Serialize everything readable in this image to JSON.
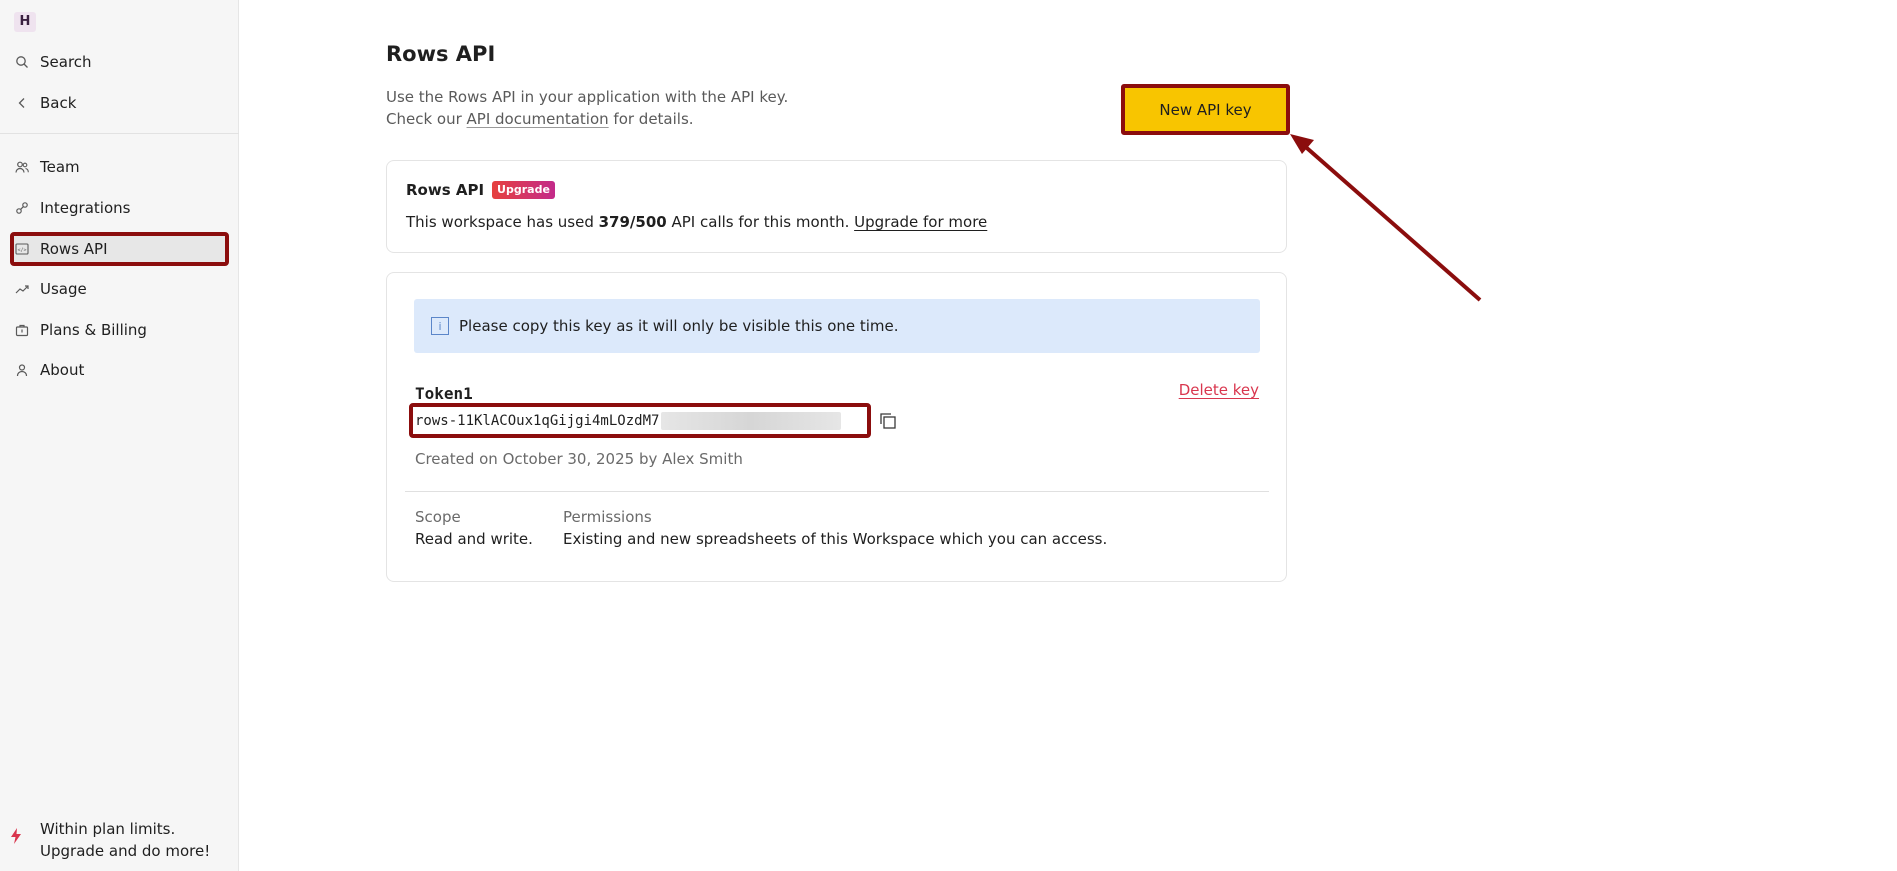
{
  "sidebar": {
    "workspace_initial": "H",
    "top_items": [
      {
        "label": "Search",
        "icon": "search-icon"
      },
      {
        "label": "Back",
        "icon": "chevron-left-icon"
      }
    ],
    "items": [
      {
        "label": "Team",
        "icon": "team-icon"
      },
      {
        "label": "Integrations",
        "icon": "integrations-icon"
      },
      {
        "label": "Rows API",
        "icon": "code-icon",
        "active": true
      },
      {
        "label": "Usage",
        "icon": "trend-icon"
      },
      {
        "label": "Plans & Billing",
        "icon": "briefcase-icon"
      },
      {
        "label": "About",
        "icon": "person-icon"
      }
    ],
    "plan_note": {
      "line1": "Within plan limits.",
      "line2": "Upgrade and do more!",
      "icon": "bolt-icon"
    }
  },
  "main": {
    "title": "Rows API",
    "desc_line1": "Use the Rows API in your application with the API key.",
    "desc_prefix": "Check our ",
    "desc_link": "API documentation",
    "desc_suffix": " for details.",
    "new_key_button": "New API key"
  },
  "usage_card": {
    "title": "Rows API",
    "badge": "Upgrade",
    "text_prefix": "This workspace has used ",
    "used": "379/500",
    "text_suffix": " API calls for this month. ",
    "link": "Upgrade for more"
  },
  "key_card": {
    "info": "Please copy this key as it will only be visible this one time.",
    "token_name": "Token1",
    "delete_label": "Delete key",
    "token_value": "rows-11KlACOux1qGijgi4mLOzdM7",
    "created": "Created on October 30, 2025 by Alex Smith",
    "scope_label": "Scope",
    "scope_value": "Read and write.",
    "permissions_label": "Permissions",
    "permissions_value": "Existing and new spreadsheets of this Workspace which you can access."
  },
  "colors": {
    "accent_button": "#f8c500",
    "annotation": "#8b0d0d",
    "danger": "#d9364e",
    "info_bg": "#dce9fb"
  }
}
